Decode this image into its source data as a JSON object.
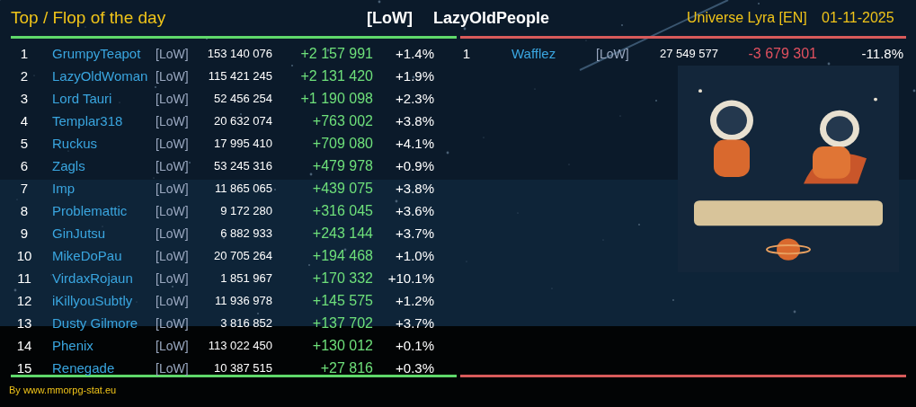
{
  "header": {
    "title": "Top / Flop of the day",
    "guild_tag": "[LoW]",
    "guild_name": "LazyOldPeople",
    "universe": "Universe Lyra [EN]",
    "date": "01-11-2025"
  },
  "panels": [
    {
      "kind": "top",
      "rows": [
        {
          "rank": "1",
          "name": "GrumpyTeapot",
          "tag": "[LoW]",
          "total": "153 140 076",
          "diff": "+2 157 991",
          "pct": "+1.4%"
        },
        {
          "rank": "2",
          "name": "LazyOldWoman",
          "tag": "[LoW]",
          "total": "115 421 245",
          "diff": "+2 131 420",
          "pct": "+1.9%"
        },
        {
          "rank": "3",
          "name": "Lord Tauri",
          "tag": "[LoW]",
          "total": "52 456 254",
          "diff": "+1 190 098",
          "pct": "+2.3%"
        },
        {
          "rank": "4",
          "name": "Templar318",
          "tag": "[LoW]",
          "total": "20 632 074",
          "diff": "+763 002",
          "pct": "+3.8%"
        },
        {
          "rank": "5",
          "name": "Ruckus",
          "tag": "[LoW]",
          "total": "17 995 410",
          "diff": "+709 080",
          "pct": "+4.1%"
        },
        {
          "rank": "6",
          "name": "Zagls",
          "tag": "[LoW]",
          "total": "53 245 316",
          "diff": "+479 978",
          "pct": "+0.9%"
        },
        {
          "rank": "7",
          "name": "Imp",
          "tag": "[LoW]",
          "total": "11 865 065",
          "diff": "+439 075",
          "pct": "+3.8%"
        },
        {
          "rank": "8",
          "name": "Problemattic",
          "tag": "[LoW]",
          "total": "9 172 280",
          "diff": "+316 045",
          "pct": "+3.6%"
        },
        {
          "rank": "9",
          "name": "GinJutsu",
          "tag": "[LoW]",
          "total": "6 882 933",
          "diff": "+243 144",
          "pct": "+3.7%"
        },
        {
          "rank": "10",
          "name": "MikeDoPau",
          "tag": "[LoW]",
          "total": "20 705 264",
          "diff": "+194 468",
          "pct": "+1.0%"
        },
        {
          "rank": "11",
          "name": "VirdaxRojaun",
          "tag": "[LoW]",
          "total": "1 851 967",
          "diff": "+170 332",
          "pct": "+10.1%"
        },
        {
          "rank": "12",
          "name": "iKillyouSubtly",
          "tag": "[LoW]",
          "total": "11 936 978",
          "diff": "+145 575",
          "pct": "+1.2%"
        },
        {
          "rank": "13",
          "name": "Dusty Gilmore",
          "tag": "[LoW]",
          "total": "3 816 852",
          "diff": "+137 702",
          "pct": "+3.7%"
        },
        {
          "rank": "14",
          "name": "Phenix",
          "tag": "[LoW]",
          "total": "113 022 450",
          "diff": "+130 012",
          "pct": "+0.1%"
        },
        {
          "rank": "15",
          "name": "Renegade",
          "tag": "[LoW]",
          "total": "10 387 515",
          "diff": "+27 816",
          "pct": "+0.3%"
        }
      ]
    },
    {
      "kind": "flop",
      "rows": [
        {
          "rank": "1",
          "name": "Wafflez",
          "tag": "[LoW]",
          "total": "27 549 577",
          "diff": "-3 679 301",
          "pct": "-11.8%"
        }
      ]
    }
  ],
  "footer": "By www.mmorpg-stat.eu"
}
